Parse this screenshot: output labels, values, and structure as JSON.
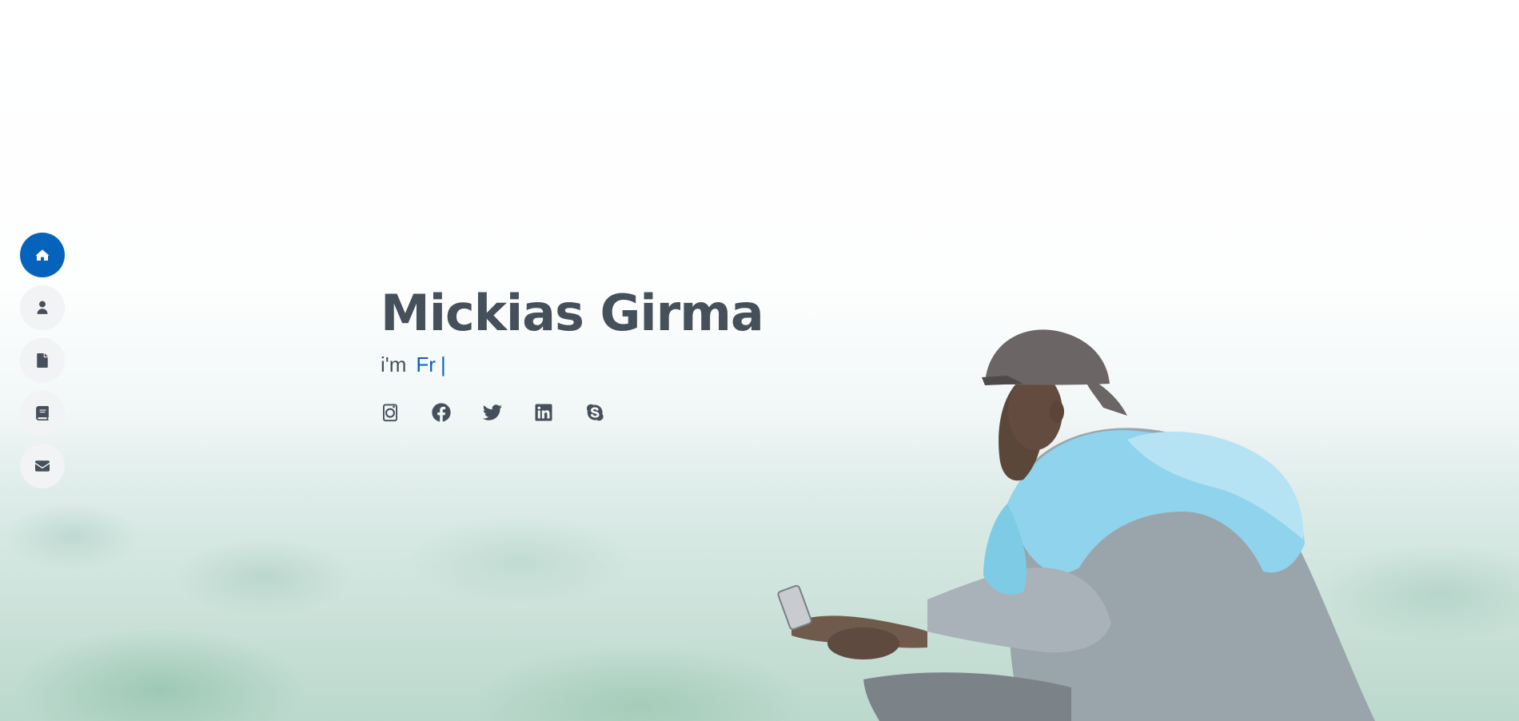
{
  "nav": {
    "items": [
      {
        "icon": "home-icon",
        "active": true
      },
      {
        "icon": "user-icon",
        "active": false
      },
      {
        "icon": "file-icon",
        "active": false
      },
      {
        "icon": "book-icon",
        "active": false
      },
      {
        "icon": "envelope-icon",
        "active": false
      }
    ]
  },
  "hero": {
    "name": "Mickias Girma",
    "prefix": "i'm",
    "typed_text": "Fr",
    "cursor": "|"
  },
  "social": [
    "instagram-icon",
    "facebook-icon",
    "twitter-icon",
    "linkedin-icon",
    "skype-icon"
  ],
  "colors": {
    "accent": "#0563bb",
    "text": "#45505b",
    "nav_bg": "#f1f3f4"
  }
}
